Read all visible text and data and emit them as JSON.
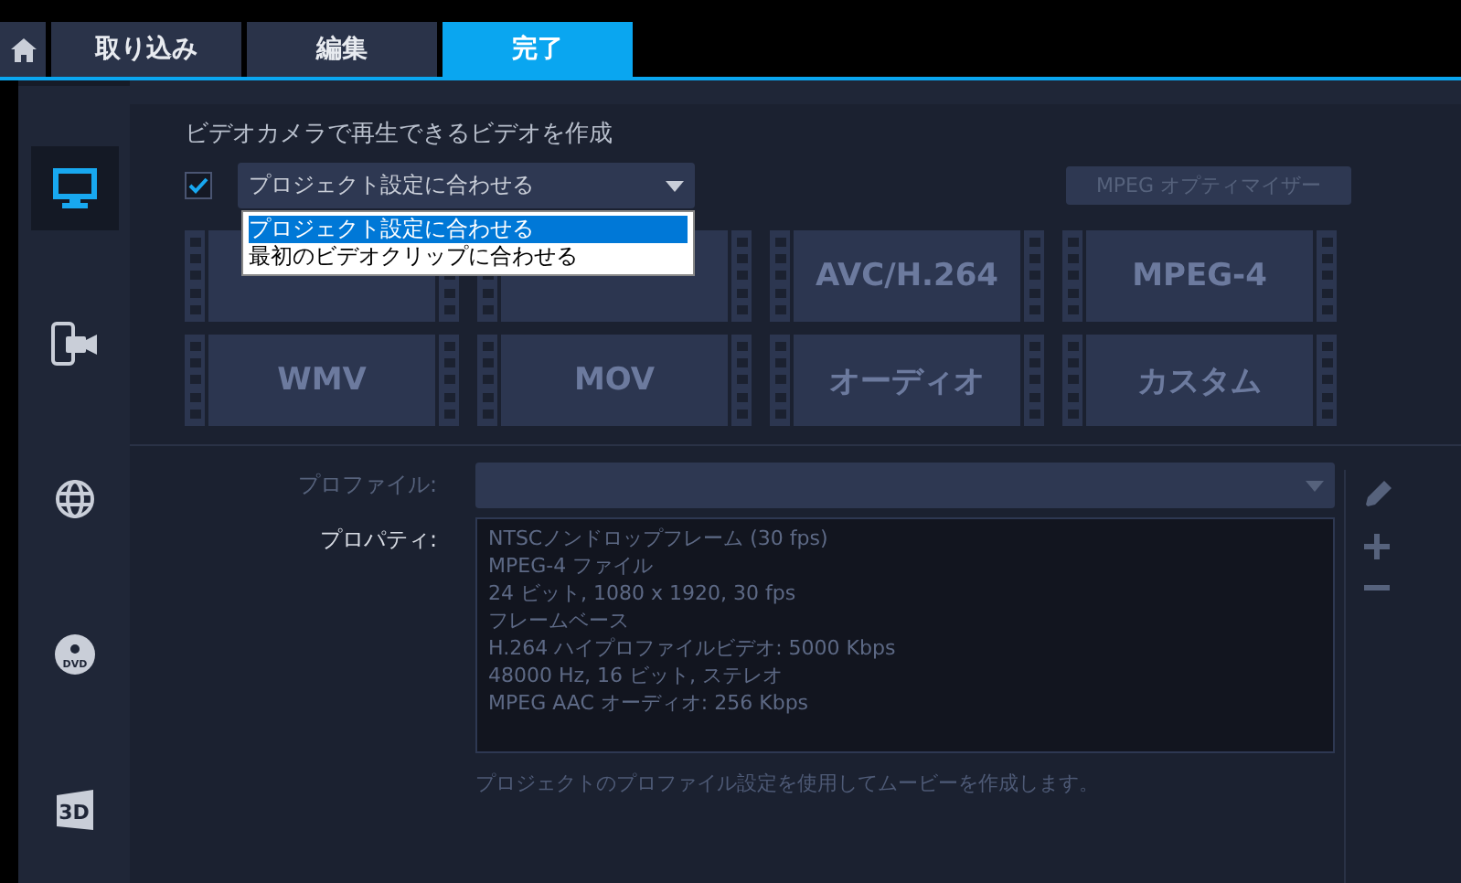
{
  "tabs": [
    {
      "kind": "home",
      "selected": false
    },
    {
      "kind": "text",
      "label": "取り込み",
      "selected": false
    },
    {
      "kind": "text",
      "label": "編集",
      "selected": false
    },
    {
      "kind": "text",
      "label": "完了",
      "selected": true
    }
  ],
  "sidebar": {
    "items": [
      {
        "kind": "monitor",
        "selected": true
      },
      {
        "kind": "phone-camera",
        "selected": false
      },
      {
        "kind": "globe",
        "selected": false
      },
      {
        "kind": "disc",
        "icon_text": "DVD",
        "selected": false
      },
      {
        "kind": "stereo",
        "icon_text": "3D",
        "selected": false
      }
    ]
  },
  "heading": "ビデオカメラで再生できるビデオを作成",
  "match_checkbox": {
    "checked": true
  },
  "match_select": {
    "value": "プロジェクト設定に合わせる",
    "open": true,
    "options": [
      {
        "label": "プロジェクト設定に合わせる",
        "selected": true
      },
      {
        "label": "最初のビデオクリップに合わせる",
        "selected": false
      }
    ]
  },
  "optimizer_button": {
    "label": "MPEG オプティマイザー"
  },
  "formats": [
    {
      "covered": true
    },
    {
      "covered": true
    },
    {
      "label": "AVC/H.264"
    },
    {
      "label": "MPEG-4"
    },
    {
      "label": "WMV"
    },
    {
      "label": "MOV"
    },
    {
      "label": "オーディオ"
    },
    {
      "label": "カスタム"
    }
  ],
  "profile": {
    "label": "プロファイル:"
  },
  "properties": {
    "label": "プロパティ:",
    "lines": [
      "NTSCノンドロップフレーム (30 fps)",
      "MPEG-4 ファイル",
      "24 ビット, 1080 x 1920, 30 fps",
      "フレームベース",
      "H.264 ハイプロファイルビデオ: 5000 Kbps",
      "48000 Hz, 16 ビット, ステレオ",
      "MPEG AAC オーディオ: 256 Kbps"
    ]
  },
  "note": "プロジェクトのプロファイル設定を使用してムービーを作成します。",
  "profile_actions": [
    {
      "kind": "edit"
    },
    {
      "kind": "add"
    },
    {
      "kind": "remove"
    }
  ]
}
